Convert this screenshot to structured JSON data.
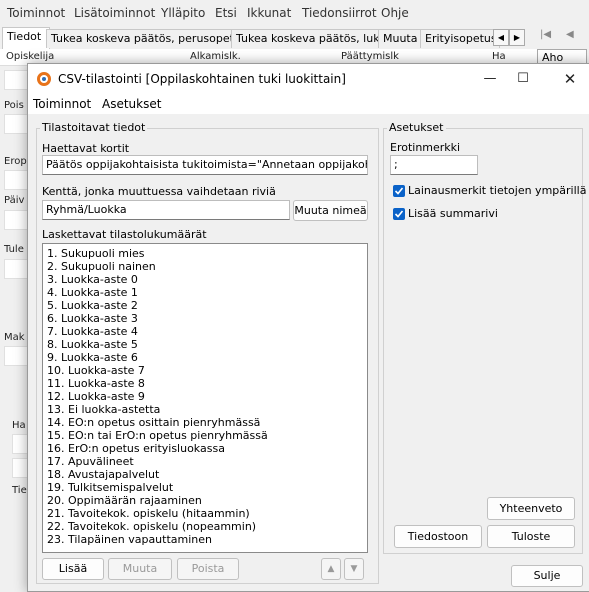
{
  "app": {
    "menu": [
      "Toiminnot",
      "Lisätoiminnot",
      "Ylläpito",
      "Etsi",
      "Ikkunat",
      "Tiedonsiirrot",
      "Ohje"
    ],
    "tabs": [
      "Tiedot",
      "Tukea koskeva päätös, perusopetus",
      "Tukea koskeva päätös, lukio",
      "Muuta",
      "Erityisopetus"
    ],
    "columns": [
      "Opiskelija",
      "Alkamislk.",
      "Päättymislk",
      "Ha"
    ],
    "side_labels": [
      "Pois",
      "Erop",
      "Päiv",
      "Tule",
      "Mak",
      "Ha",
      "Tie"
    ],
    "right_field": "Aho"
  },
  "dialog": {
    "title": "CSV-tilastointi [Oppilaskohtainen tuki luokittain]",
    "menu": [
      "Toiminnot",
      "Asetukset"
    ],
    "left_group": "Tilastoitavat tiedot",
    "haettavat_label": "Haettavat kortit",
    "haettavat_value": "Päätös oppijakohtaisista tukitoimista=\"Annetaan oppijakohtaisia tu",
    "kentta_label": "Kenttä, jonka muuttuessa vaihdetaan riviä",
    "kentta_value": "Ryhmä/Luokka",
    "muuta_nimea": "Muuta nimeä",
    "lasket_label": "Laskettavat tilastolukumäärät",
    "items": [
      "1. Sukupuoli mies",
      "2. Sukupuoli nainen",
      "3. Luokka-aste 0",
      "4. Luokka-aste 1",
      "5. Luokka-aste 2",
      "6. Luokka-aste 3",
      "7. Luokka-aste 4",
      "8. Luokka-aste 5",
      "9. Luokka-aste 6",
      "10. Luokka-aste 7",
      "11. Luokka-aste 8",
      "12. Luokka-aste 9",
      "13. Ei luokka-astetta",
      "14. EO:n opetus osittain pienryhmässä",
      "15. EO:n tai ErO:n opetus pienryhmässä",
      "16. ErO:n opetus erityisluokassa",
      "17. Apuvälineet",
      "18. Avustajapalvelut",
      "19. Tulkitsemispalvelut",
      "20. Oppimäärän rajaaminen",
      "21. Tavoitekok. opiskelu (hitaammin)",
      "22. Tavoitekok. opiskelu (nopeammin)",
      "23. Tilapäinen vapauttaminen"
    ],
    "btn_lisaa": "Lisää",
    "btn_muuta": "Muuta",
    "btn_poista": "Poista",
    "right_group": "Asetukset",
    "erotin_label": "Erotinmerkki",
    "erotin_value": ";",
    "chk1": "Lainausmerkit tietojen ympärillä",
    "chk2": "Lisää summarivi",
    "btn_yhteenveto": "Yhteenveto",
    "btn_tiedostoon": "Tiedostoon",
    "btn_tuloste": "Tuloste",
    "btn_sulje": "Sulje"
  }
}
